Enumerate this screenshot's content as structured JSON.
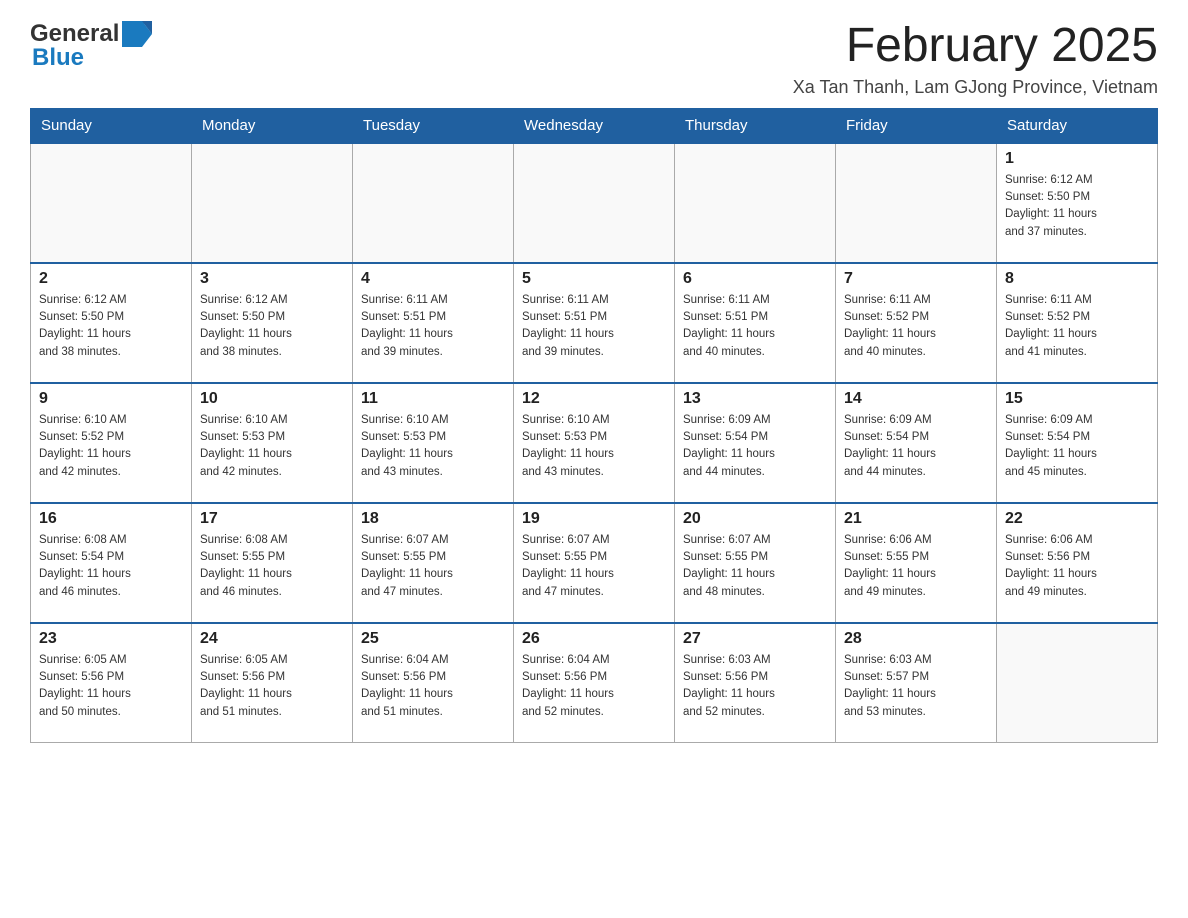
{
  "header": {
    "logo": {
      "text_general": "General",
      "text_blue": "Blue"
    },
    "title": "February 2025",
    "subtitle": "Xa Tan Thanh, Lam GJong Province, Vietnam"
  },
  "weekdays": [
    "Sunday",
    "Monday",
    "Tuesday",
    "Wednesday",
    "Thursday",
    "Friday",
    "Saturday"
  ],
  "weeks": [
    [
      {
        "day": "",
        "info": ""
      },
      {
        "day": "",
        "info": ""
      },
      {
        "day": "",
        "info": ""
      },
      {
        "day": "",
        "info": ""
      },
      {
        "day": "",
        "info": ""
      },
      {
        "day": "",
        "info": ""
      },
      {
        "day": "1",
        "info": "Sunrise: 6:12 AM\nSunset: 5:50 PM\nDaylight: 11 hours\nand 37 minutes."
      }
    ],
    [
      {
        "day": "2",
        "info": "Sunrise: 6:12 AM\nSunset: 5:50 PM\nDaylight: 11 hours\nand 38 minutes."
      },
      {
        "day": "3",
        "info": "Sunrise: 6:12 AM\nSunset: 5:50 PM\nDaylight: 11 hours\nand 38 minutes."
      },
      {
        "day": "4",
        "info": "Sunrise: 6:11 AM\nSunset: 5:51 PM\nDaylight: 11 hours\nand 39 minutes."
      },
      {
        "day": "5",
        "info": "Sunrise: 6:11 AM\nSunset: 5:51 PM\nDaylight: 11 hours\nand 39 minutes."
      },
      {
        "day": "6",
        "info": "Sunrise: 6:11 AM\nSunset: 5:51 PM\nDaylight: 11 hours\nand 40 minutes."
      },
      {
        "day": "7",
        "info": "Sunrise: 6:11 AM\nSunset: 5:52 PM\nDaylight: 11 hours\nand 40 minutes."
      },
      {
        "day": "8",
        "info": "Sunrise: 6:11 AM\nSunset: 5:52 PM\nDaylight: 11 hours\nand 41 minutes."
      }
    ],
    [
      {
        "day": "9",
        "info": "Sunrise: 6:10 AM\nSunset: 5:52 PM\nDaylight: 11 hours\nand 42 minutes."
      },
      {
        "day": "10",
        "info": "Sunrise: 6:10 AM\nSunset: 5:53 PM\nDaylight: 11 hours\nand 42 minutes."
      },
      {
        "day": "11",
        "info": "Sunrise: 6:10 AM\nSunset: 5:53 PM\nDaylight: 11 hours\nand 43 minutes."
      },
      {
        "day": "12",
        "info": "Sunrise: 6:10 AM\nSunset: 5:53 PM\nDaylight: 11 hours\nand 43 minutes."
      },
      {
        "day": "13",
        "info": "Sunrise: 6:09 AM\nSunset: 5:54 PM\nDaylight: 11 hours\nand 44 minutes."
      },
      {
        "day": "14",
        "info": "Sunrise: 6:09 AM\nSunset: 5:54 PM\nDaylight: 11 hours\nand 44 minutes."
      },
      {
        "day": "15",
        "info": "Sunrise: 6:09 AM\nSunset: 5:54 PM\nDaylight: 11 hours\nand 45 minutes."
      }
    ],
    [
      {
        "day": "16",
        "info": "Sunrise: 6:08 AM\nSunset: 5:54 PM\nDaylight: 11 hours\nand 46 minutes."
      },
      {
        "day": "17",
        "info": "Sunrise: 6:08 AM\nSunset: 5:55 PM\nDaylight: 11 hours\nand 46 minutes."
      },
      {
        "day": "18",
        "info": "Sunrise: 6:07 AM\nSunset: 5:55 PM\nDaylight: 11 hours\nand 47 minutes."
      },
      {
        "day": "19",
        "info": "Sunrise: 6:07 AM\nSunset: 5:55 PM\nDaylight: 11 hours\nand 47 minutes."
      },
      {
        "day": "20",
        "info": "Sunrise: 6:07 AM\nSunset: 5:55 PM\nDaylight: 11 hours\nand 48 minutes."
      },
      {
        "day": "21",
        "info": "Sunrise: 6:06 AM\nSunset: 5:55 PM\nDaylight: 11 hours\nand 49 minutes."
      },
      {
        "day": "22",
        "info": "Sunrise: 6:06 AM\nSunset: 5:56 PM\nDaylight: 11 hours\nand 49 minutes."
      }
    ],
    [
      {
        "day": "23",
        "info": "Sunrise: 6:05 AM\nSunset: 5:56 PM\nDaylight: 11 hours\nand 50 minutes."
      },
      {
        "day": "24",
        "info": "Sunrise: 6:05 AM\nSunset: 5:56 PM\nDaylight: 11 hours\nand 51 minutes."
      },
      {
        "day": "25",
        "info": "Sunrise: 6:04 AM\nSunset: 5:56 PM\nDaylight: 11 hours\nand 51 minutes."
      },
      {
        "day": "26",
        "info": "Sunrise: 6:04 AM\nSunset: 5:56 PM\nDaylight: 11 hours\nand 52 minutes."
      },
      {
        "day": "27",
        "info": "Sunrise: 6:03 AM\nSunset: 5:56 PM\nDaylight: 11 hours\nand 52 minutes."
      },
      {
        "day": "28",
        "info": "Sunrise: 6:03 AM\nSunset: 5:57 PM\nDaylight: 11 hours\nand 53 minutes."
      },
      {
        "day": "",
        "info": ""
      }
    ]
  ]
}
